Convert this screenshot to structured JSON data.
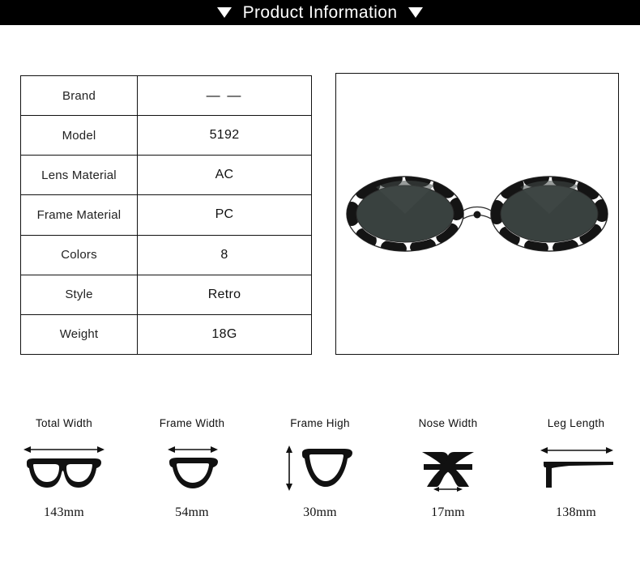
{
  "header": {
    "title": "Product Information",
    "left_triangle": "triangle-down-icon",
    "right_triangle": "triangle-down-icon",
    "background_color": "#000000",
    "text_color": "#ffffff"
  },
  "spec_table": {
    "rows": [
      {
        "label": "Brand",
        "value": "— —"
      },
      {
        "label": "Model",
        "value": "5192"
      },
      {
        "label": "Lens Material",
        "value": "AC"
      },
      {
        "label": "Frame Material",
        "value": "PC"
      },
      {
        "label": "Colors",
        "value": "8"
      },
      {
        "label": "Style",
        "value": "Retro"
      },
      {
        "label": "Weight",
        "value": "18G"
      }
    ],
    "border_color": "#111111"
  },
  "product_image": {
    "alt": "oval sunglasses with black and white cow print frame and dark lenses",
    "frame_base_color": "#ffffff",
    "frame_spot_color": "#141414",
    "lens_color": "#39413f",
    "border_color": "#111111"
  },
  "measurements": [
    {
      "label": "Total Width",
      "value": "143mm",
      "icon": "glasses-front-full-icon",
      "arrow": "horizontal-double-arrow-icon"
    },
    {
      "label": "Frame Width",
      "value": "54mm",
      "icon": "glasses-single-lens-icon",
      "arrow": "horizontal-double-arrow-icon"
    },
    {
      "label": "Frame High",
      "value": "30mm",
      "icon": "glasses-single-lens-icon",
      "arrow": "vertical-double-arrow-icon"
    },
    {
      "label": "Nose Width",
      "value": "17mm",
      "icon": "glasses-bridge-icon",
      "arrow": "horizontal-double-arrow-icon"
    },
    {
      "label": "Leg Length",
      "value": "138mm",
      "icon": "glasses-temple-arm-icon",
      "arrow": "horizontal-double-arrow-icon"
    }
  ]
}
